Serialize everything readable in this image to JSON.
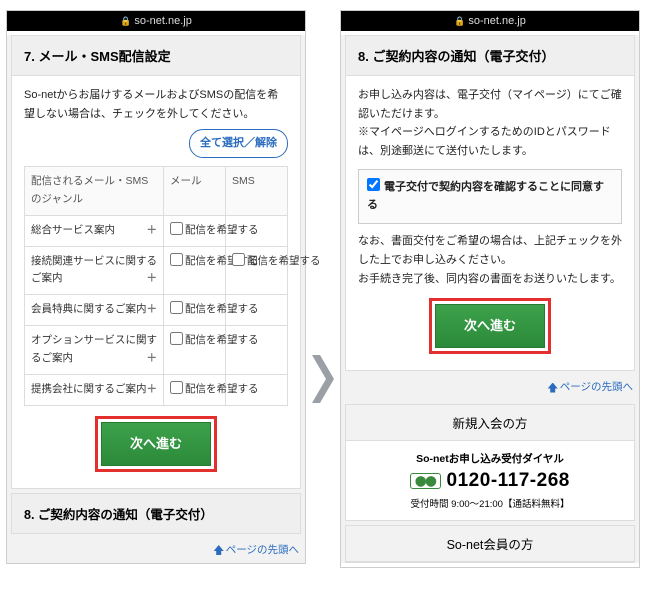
{
  "urlbar": {
    "host": "so-net.ne.jp"
  },
  "left": {
    "section7": {
      "title": "7. メール・SMS配信設定",
      "intro": "So-netからお届けするメールおよびSMSの配信を希望しない場合は、チェックを外してください。",
      "toggleAll": "全て選択／解除",
      "headers": {
        "genre": "配信されるメール・SMSのジャンル",
        "mail": "メール",
        "sms": "SMS"
      },
      "prefLabel": "配信を希望する",
      "rows": [
        {
          "label": "総合サービス案内",
          "mail": true,
          "sms": false
        },
        {
          "label": "接続関連サービスに関するご案内",
          "mail": true,
          "sms": true
        },
        {
          "label": "会員特典に関するご案内",
          "mail": true,
          "sms": false
        },
        {
          "label": "オプションサービスに関するご案内",
          "mail": true,
          "sms": false
        },
        {
          "label": "提携会社に関するご案内",
          "mail": true,
          "sms": false
        }
      ],
      "next": "次へ進む"
    },
    "section8head": "8. ご契約内容の通知（電子交付）",
    "pagetop": "ページの先頭へ"
  },
  "right": {
    "section8": {
      "title": "8. ご契約内容の通知（電子交付）",
      "p1": "お申し込み内容は、電子交付（マイページ）にてご確認いただけます。",
      "p2": "※マイページへログインするためのIDとパスワードは、別途郵送にて送付いたします。",
      "consent": "電子交付で契約内容を確認することに同意する",
      "p3": "なお、書面交付をご希望の場合は、上記チェックを外した上でお申し込みください。",
      "p4": "お手続き完了後、同内容の書面をお送りいたします。",
      "next": "次へ進む"
    },
    "pagetop": "ページの先頭へ",
    "newMember": {
      "head": "新規入会の方",
      "sub": "So-netお申し込み受付ダイヤル",
      "dial": "0120-117-268",
      "hours": "受付時間 9:00〜21:00【通話料無料】"
    },
    "existing": {
      "head": "So-net会員の方"
    }
  }
}
